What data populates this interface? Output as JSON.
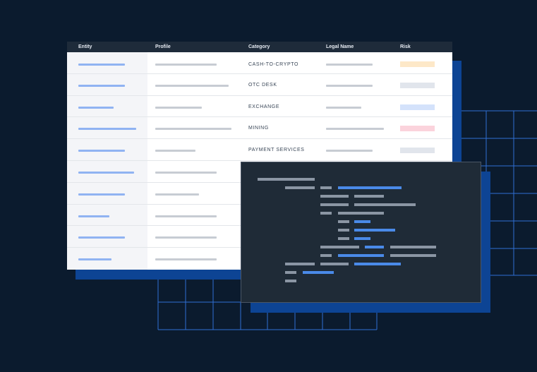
{
  "table": {
    "headers": {
      "entity": "Entity",
      "profile": "Profile",
      "category": "Category",
      "legal_name": "Legal Name",
      "risk": "Risk"
    },
    "categories": [
      "CASH-TO-CRYPTO",
      "OTC DESK",
      "EXCHANGE",
      "MINING",
      "PAYMENT SERVICES"
    ],
    "risk_colors": [
      "#fde8c8",
      "#e1e5ec",
      "#d4e2fb",
      "#fbd3dc",
      "#e1e5ec"
    ]
  },
  "colors": {
    "background": "#0b1b2e",
    "accent_blue": "#0d4494",
    "grid_line": "#2f6fd4",
    "code_bg": "#1f2b37"
  }
}
